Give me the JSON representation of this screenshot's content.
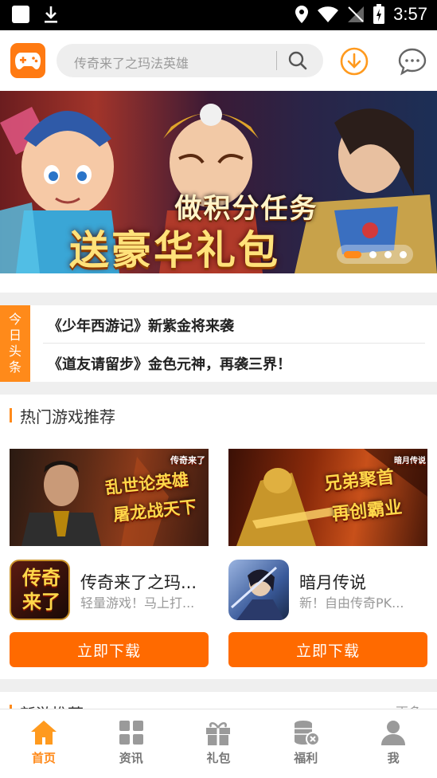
{
  "status_bar": {
    "time": "3:57"
  },
  "search": {
    "placeholder": "传奇来了之玛法英雄"
  },
  "banner": {
    "line1": "做积分任务",
    "line2": "送豪华礼包",
    "dots": 4,
    "active_dot": 0
  },
  "headlines": {
    "tag": "今日头条",
    "items": [
      "《少年西游记》新紫金将来袭",
      "《道友请留步》金色元神，再袭三界！"
    ]
  },
  "hot_section": {
    "title": "热门游戏推荐",
    "games": [
      {
        "cover_text_1": "乱世论英雄",
        "cover_text_2": "屠龙战天下",
        "cover_badge": "传奇来了",
        "icon_text": "传奇来了",
        "name": "传奇来了之玛...",
        "desc": "轻量游戏！马上打...",
        "button": "立即下载"
      },
      {
        "cover_text_1": "兄弟聚首",
        "cover_text_2": "再创霸业",
        "cover_badge": "暗月传说",
        "icon_text": "",
        "name": "暗月传说",
        "desc": "新！自由传奇PK...",
        "button": "立即下载"
      }
    ]
  },
  "new_section": {
    "title": "新游推荐",
    "more": "更多"
  },
  "bottom_nav": [
    {
      "label": "首页",
      "icon": "home-icon",
      "active": true
    },
    {
      "label": "资讯",
      "icon": "grid-icon",
      "active": false
    },
    {
      "label": "礼包",
      "icon": "gift-icon",
      "active": false
    },
    {
      "label": "福利",
      "icon": "coins-icon",
      "active": false
    },
    {
      "label": "我",
      "icon": "user-icon",
      "active": false
    }
  ],
  "colors": {
    "accent": "#ff8a1a",
    "button": "#ff6a00",
    "divider": "#efefef"
  }
}
